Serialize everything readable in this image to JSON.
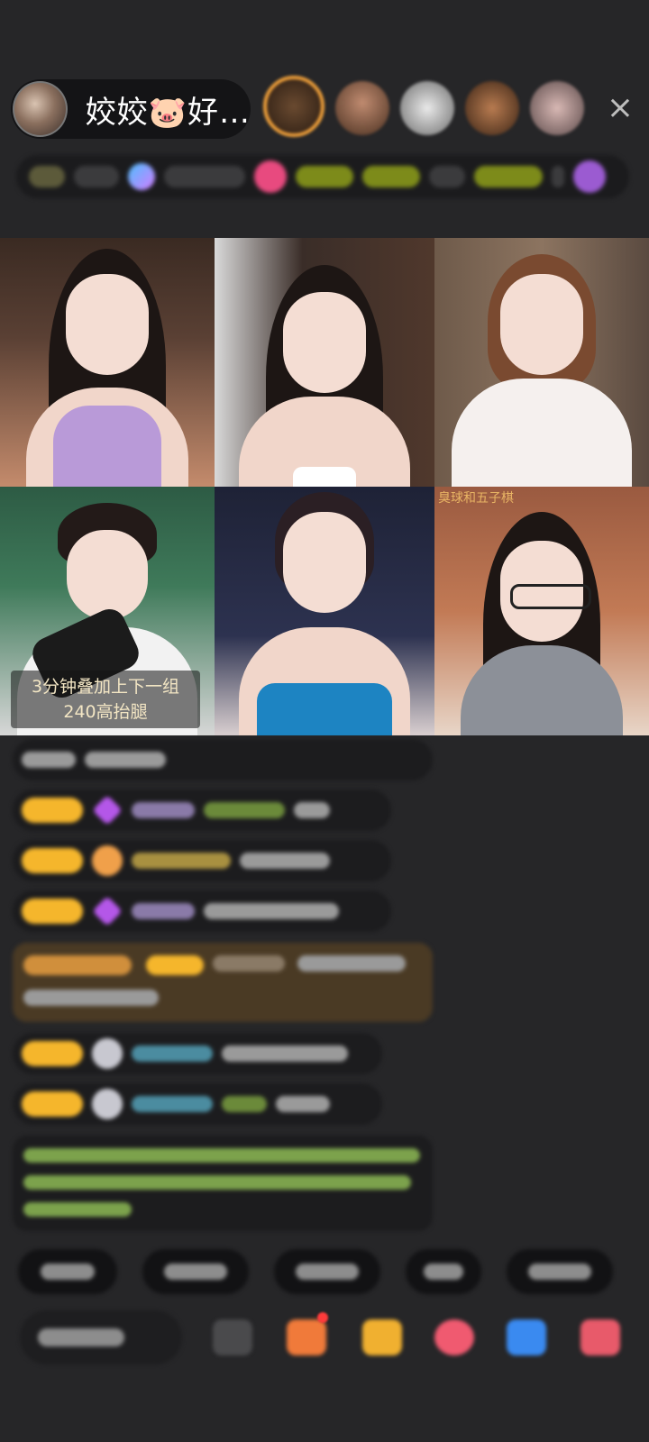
{
  "header": {
    "host_name": "姣姣🐷好…",
    "close_icon": "×",
    "viewers": [
      "viewer-1",
      "viewer-2",
      "viewer-3",
      "viewer-4",
      "viewer-5"
    ]
  },
  "streams": [
    {
      "id": "stream-1"
    },
    {
      "id": "stream-2"
    },
    {
      "id": "stream-3"
    },
    {
      "id": "stream-4",
      "caption_line1": "3分钟叠加上下一组",
      "caption_line2": "240高抬腿"
    },
    {
      "id": "stream-5"
    },
    {
      "id": "stream-6",
      "tag": "臭球和五子棋"
    }
  ],
  "chat": {
    "messages_blurred": true
  },
  "toolbar": {
    "icons": [
      "keyboard-icon",
      "gift-box-icon",
      "lucky-bag-icon",
      "red-heart-icon",
      "game-icon",
      "more-icon"
    ]
  },
  "colors": {
    "background": "#262628",
    "accent_orange": "#f0a03a",
    "level_badge": "#f5b62c"
  }
}
